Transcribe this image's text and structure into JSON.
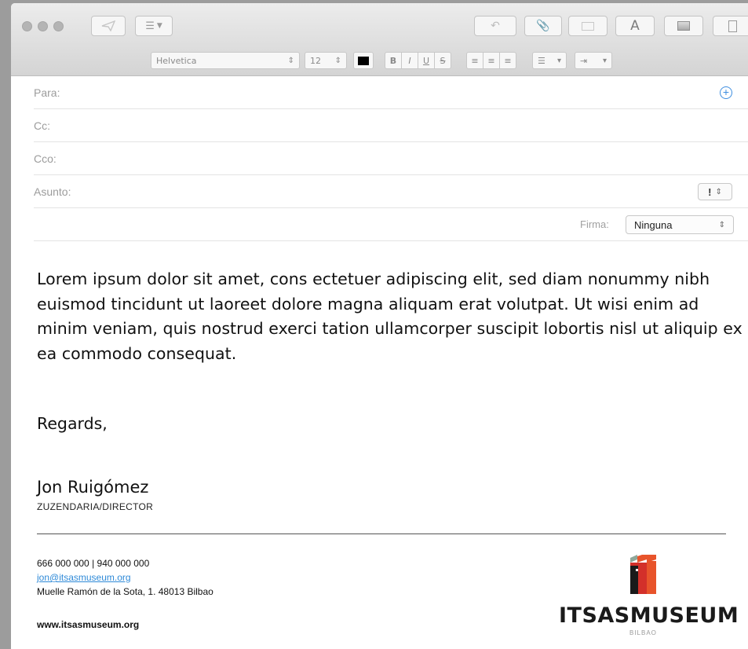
{
  "toolbar": {
    "font_name": "Helvetica",
    "font_size": "12",
    "text_color": "#000000",
    "bold_label": "B",
    "italic_label": "I",
    "underline_label": "U",
    "strike_label": "S",
    "font_button_label": "A"
  },
  "headers": {
    "to_label": "Para:",
    "cc_label": "Cc:",
    "bcc_label": "Cco:",
    "subject_label": "Asunto:",
    "priority_value": "!",
    "signature_label": "Firma:",
    "signature_value": "Ninguna"
  },
  "message": {
    "body": "Lorem ipsum dolor sit amet, cons ectetuer adipiscing elit, sed diam nonummy nibh euismod tincidunt ut laoreet dolore magna aliquam erat volutpat. Ut wisi enim ad minim veniam, quis nostrud exerci tation ullamcorper suscipit lobortis nisl ut aliquip ex ea commodo consequat.",
    "closing": "Regards,"
  },
  "signature": {
    "name": "Jon Ruigómez",
    "title": "ZUZENDARIA/DIRECTOR",
    "phones": "666 000 000 | 940 000 000",
    "email": "jon@itsasmuseum.org",
    "address": "Muelle Ramón de la Sota, 1. 48013 Bilbao",
    "website": "www.itsasmuseum.org",
    "logo_word": "ITSASMUSEUM",
    "logo_sub": "BILBAO"
  },
  "colors": {
    "link": "#2f8ad8",
    "logo_red": "#d3302a",
    "logo_orange": "#e8542b",
    "logo_green": "#8fa89a"
  }
}
